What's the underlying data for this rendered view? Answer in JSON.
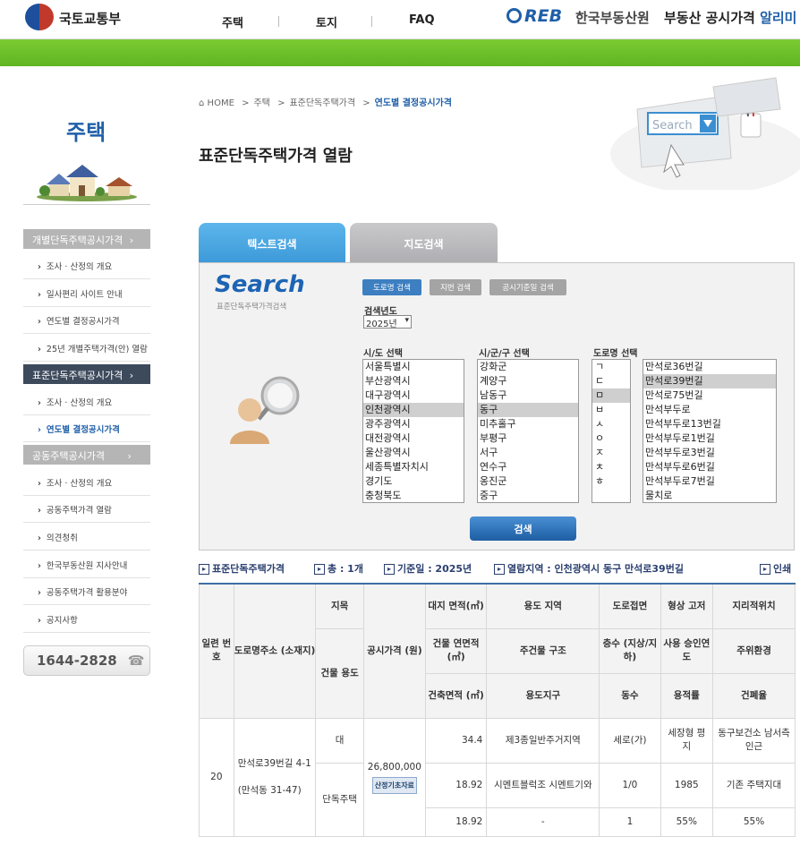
{
  "header": {
    "gov_name": "국토교통부",
    "nav": [
      "주택",
      "토지",
      "FAQ"
    ],
    "reb_logo": "REB",
    "reb_name": "한국부동산원",
    "alimi_prefix": "부동산 공시가격",
    "alimi_suffix": "알리미"
  },
  "sidebar": {
    "title": "주택",
    "categories": [
      {
        "label": "개별단독주택공시가격",
        "items": [
          "조사 · 산정의 개요",
          "일사편리 사이트 안내",
          "연도별 결정공시가격",
          "25년 개별주택가격(안) 열람"
        ]
      },
      {
        "label": "표준단독주택공시가격",
        "items": [
          "조사 · 산정의 개요",
          "연도별 결정공시가격"
        ]
      },
      {
        "label": "공동주택공시가격",
        "items": [
          "조사 · 산정의 개요",
          "공동주택가격 열람",
          "의견청취",
          "한국부동산원 지사안내",
          "공동주택가격 활용분야",
          "공지사항"
        ]
      }
    ],
    "phone": "1644-2828"
  },
  "breadcrumb": {
    "home": "HOME",
    "level1": "주택",
    "level2": "표준단독주택가격",
    "current": "연도별 결정공시가격"
  },
  "page_title": "표준단독주택가격 열람",
  "tabs": {
    "text": "텍스트검색",
    "map": "지도검색"
  },
  "search": {
    "logo": "Search",
    "sub": "표준단독주택가격검색",
    "mode_buttons": [
      "도로명 검색",
      "지번 검색",
      "공시기준일 검색"
    ],
    "year_label": "검색년도",
    "year_value": "2025년",
    "sido_label": "시/도 선택",
    "sigungu_label": "시/군/구 선택",
    "road_label": "도로명 선택",
    "sido": [
      "서울특별시",
      "부산광역시",
      "대구광역시",
      "인천광역시",
      "광주광역시",
      "대전광역시",
      "울산광역시",
      "세종특별자치시",
      "경기도",
      "충청북도"
    ],
    "sido_selected": 3,
    "sigungu": [
      "강화군",
      "계양구",
      "남동구",
      "동구",
      "미추홀구",
      "부평구",
      "서구",
      "연수구",
      "옹진군",
      "중구"
    ],
    "sigungu_selected": 3,
    "initials": [
      "ㄱ",
      "ㄷ",
      "ㅁ",
      "ㅂ",
      "ㅅ",
      "ㅇ",
      "ㅈ",
      "ㅊ",
      "ㅎ"
    ],
    "initial_selected": 2,
    "roads": [
      "만석로36번길",
      "만석로39번길",
      "만석로75번길",
      "만석부두로",
      "만석부두로13번길",
      "만석부두로1번길",
      "만석부두로3번길",
      "만석부두로6번길",
      "만석부두로7번길",
      "물치로"
    ],
    "road_selected": 1,
    "button": "검색"
  },
  "info_bar": {
    "title": "표준단독주택가격",
    "total": "총 : 1개",
    "base_date": "기준일 : 2025년",
    "area": "열람지역 : 인천광역시 동구 만석로39번길",
    "print": "인쇄"
  },
  "table": {
    "h_serial": "일련 번호",
    "h_address": "도로명주소 (소재지)",
    "h_jimok": "지목",
    "h_bldg_use": "건물 용도",
    "h_price": "공시가격 (원)",
    "h_land_area": "대지 면적(㎡)",
    "h_zone": "용도 지역",
    "h_road": "도로접면",
    "h_shape": "형상 고저",
    "h_geo": "지리적위치",
    "h_bldg_area": "건물 연면적(㎡)",
    "h_structure": "주건물 구조",
    "h_floors": "층수 (지상/지하)",
    "h_year": "사용 승인연도",
    "h_env": "주위환경",
    "h_build_area": "건축면적 (㎡)",
    "h_district": "용도지구",
    "h_dong": "동수",
    "h_far": "용적률",
    "h_bcr": "건폐율",
    "row": {
      "serial": "20",
      "address": "만석로39번길 4-1",
      "lot": "(만석동 31-47)",
      "jimok": "대",
      "bldg_use": "단독주택",
      "price": "26,800,000",
      "basis_btn": "산정기초자료",
      "land_area": "34.4",
      "zone": "제3종일반주거지역",
      "road": "세로(가)",
      "shape": "세장형 평지",
      "geo": "동구보건소 남서측 인근",
      "bldg_area": "18.92",
      "structure": "시멘트블럭조 시멘트기와",
      "floors": "1/0",
      "year": "1985",
      "env": "기존 주택지대",
      "build_area": "18.92",
      "district": "-",
      "dong": "1",
      "far": "55%",
      "bcr": "55%"
    }
  }
}
